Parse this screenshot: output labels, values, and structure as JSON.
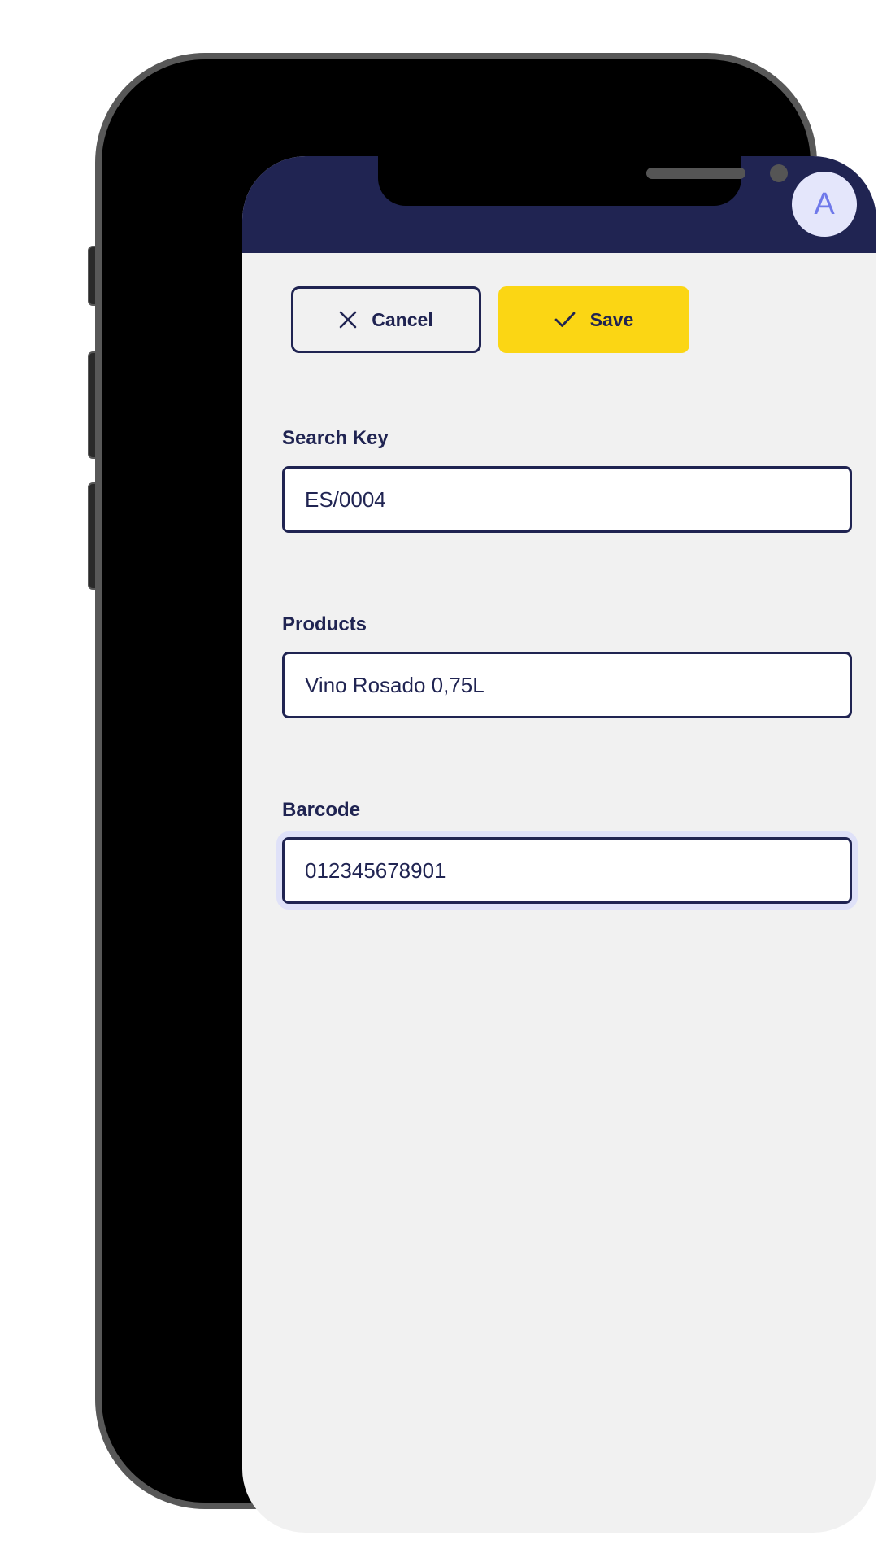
{
  "header": {
    "avatar_initial": "A",
    "background_color": "#202452"
  },
  "toolbar": {
    "cancel_label": "Cancel",
    "save_label": "Save",
    "save_color": "#fbd614"
  },
  "form": {
    "fields": [
      {
        "label": "Search Key",
        "value": "ES/0004"
      },
      {
        "label": "Products",
        "value": "Vino Rosado 0,75L"
      },
      {
        "label": "Barcode",
        "value": "012345678901",
        "focused": true
      }
    ]
  },
  "icons": {
    "cancel": "close-icon",
    "save": "check-icon"
  }
}
